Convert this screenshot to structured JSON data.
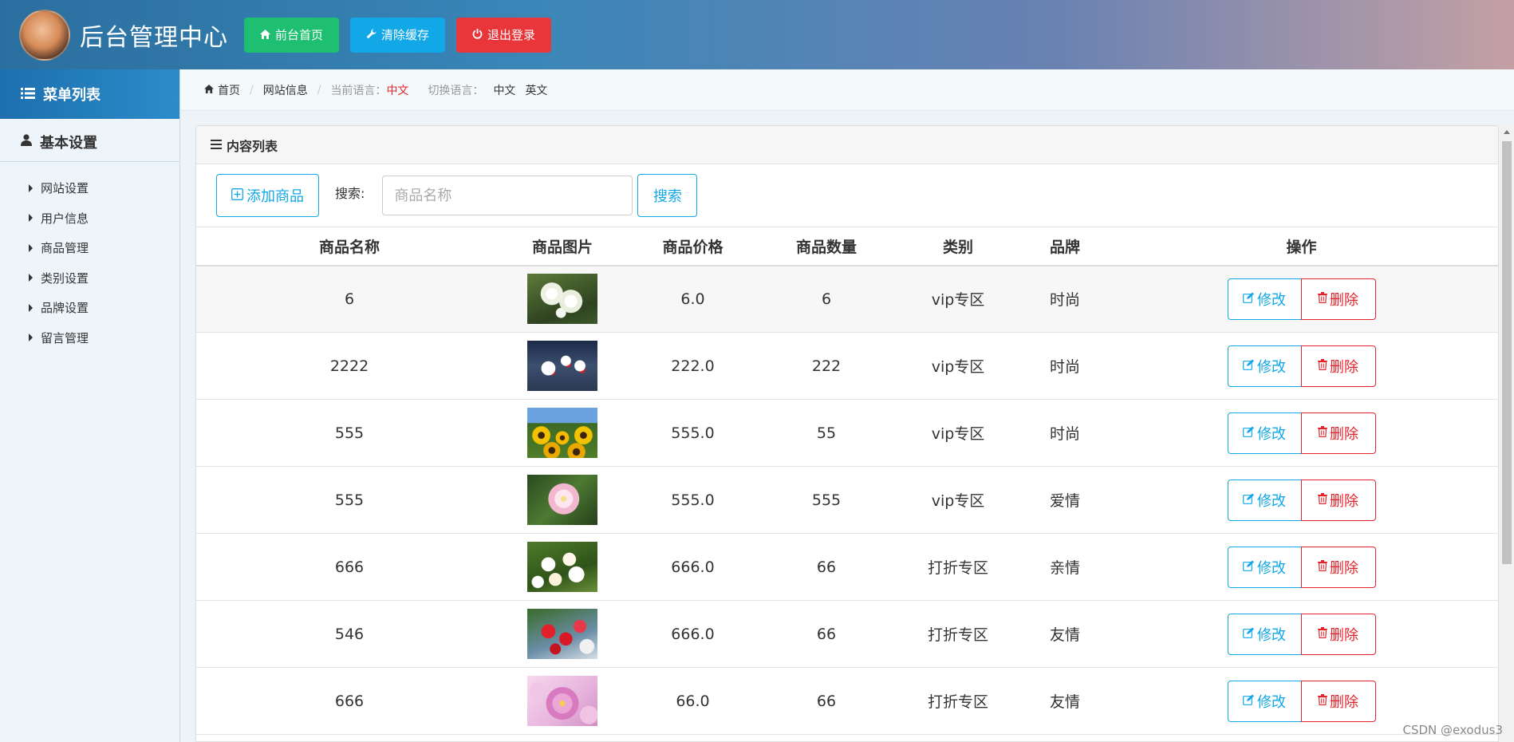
{
  "header": {
    "title": "后台管理中心",
    "buttons": [
      {
        "label": "前台首页",
        "icon": "home-icon",
        "color": "#1fbf72"
      },
      {
        "label": "清除缓存",
        "icon": "wrench-icon",
        "color": "#12a7e6"
      },
      {
        "label": "退出登录",
        "icon": "power-icon",
        "color": "#e8363b"
      }
    ]
  },
  "sidebar": {
    "menu_title": "菜单列表",
    "group_title": "基本设置",
    "items": [
      {
        "label": "网站设置"
      },
      {
        "label": "用户信息"
      },
      {
        "label": "商品管理"
      },
      {
        "label": "类别设置"
      },
      {
        "label": "品牌设置"
      },
      {
        "label": "留言管理"
      }
    ]
  },
  "breadcrumb": {
    "home": "首页",
    "current": "网站信息",
    "lang_label": "当前语言：",
    "lang_value": "中文",
    "switch_label": "切换语言：",
    "switch_options": [
      "中文",
      "英文"
    ]
  },
  "panel": {
    "title": "内容列表",
    "add_button": "添加商品",
    "search_label": "搜索:",
    "search_placeholder": "商品名称",
    "search_button": "搜索"
  },
  "table": {
    "headers": [
      "商品名称",
      "商品图片",
      "商品价格",
      "商品数量",
      "类别",
      "品牌",
      "操作"
    ],
    "edit_label": "修改",
    "delete_label": "删除",
    "rows": [
      {
        "name": "6",
        "image": "white-flowers",
        "price": "6.0",
        "qty": "6",
        "category": "vip专区",
        "brand": "时尚"
      },
      {
        "name": "2222",
        "image": "white-red-flowers",
        "price": "222.0",
        "qty": "222",
        "category": "vip专区",
        "brand": "时尚"
      },
      {
        "name": "555",
        "image": "sunflowers",
        "price": "555.0",
        "qty": "55",
        "category": "vip专区",
        "brand": "时尚"
      },
      {
        "name": "555",
        "image": "pink-dahlia",
        "price": "555.0",
        "qty": "555",
        "category": "vip专区",
        "brand": "爱情"
      },
      {
        "name": "666",
        "image": "white-bouquet",
        "price": "666.0",
        "qty": "66",
        "category": "打折专区",
        "brand": "亲情"
      },
      {
        "name": "546",
        "image": "red-roses",
        "price": "666.0",
        "qty": "66",
        "category": "打折专区",
        "brand": "友情"
      },
      {
        "name": "666",
        "image": "pink-daisy",
        "price": "66.0",
        "qty": "66",
        "category": "打折专区",
        "brand": "友情"
      }
    ]
  },
  "watermark": "CSDN @exodus3"
}
